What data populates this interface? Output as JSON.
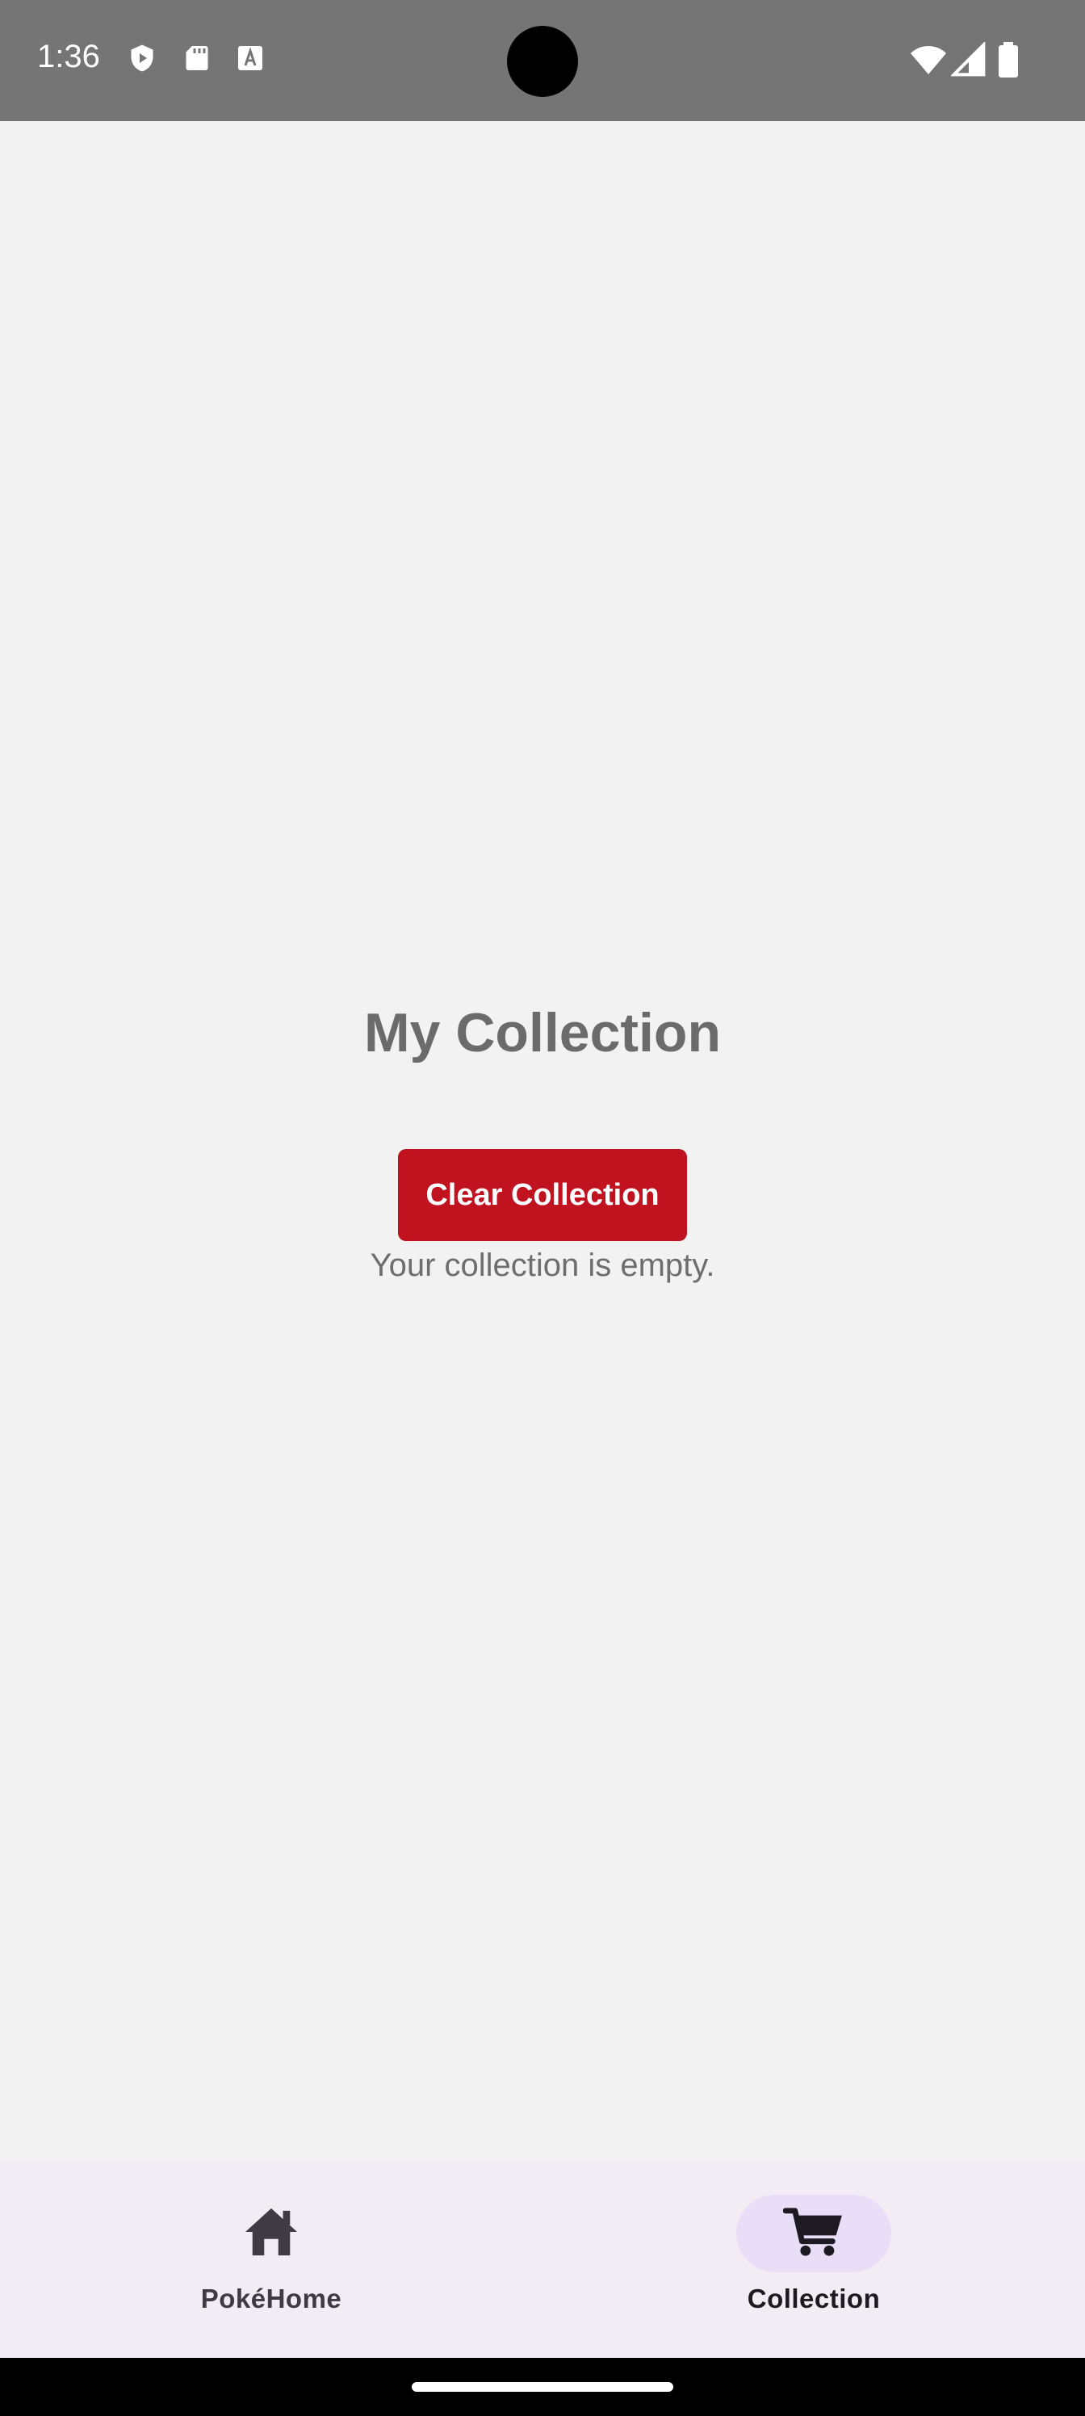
{
  "status_bar": {
    "time": "1:36",
    "left_icons": [
      "shield-play-icon",
      "sd-card-icon",
      "font-a-icon"
    ],
    "right_icons": [
      "wifi-icon",
      "cellular-signal-icon",
      "battery-icon"
    ]
  },
  "main": {
    "title": "My Collection",
    "clear_button_label": "Clear Collection",
    "empty_message": "Your collection is empty."
  },
  "bottom_nav": {
    "items": [
      {
        "label": "PokéHome",
        "icon": "home-icon",
        "selected": false
      },
      {
        "label": "Collection",
        "icon": "cart-icon",
        "selected": true
      }
    ]
  },
  "colors": {
    "status_bar_bg": "#757575",
    "page_bg": "#f2f2f2",
    "button_bg": "#c0121f",
    "title_text": "#6b6b6b",
    "nav_bg": "#f2edf4",
    "nav_selected_pill": "#e8def8"
  }
}
